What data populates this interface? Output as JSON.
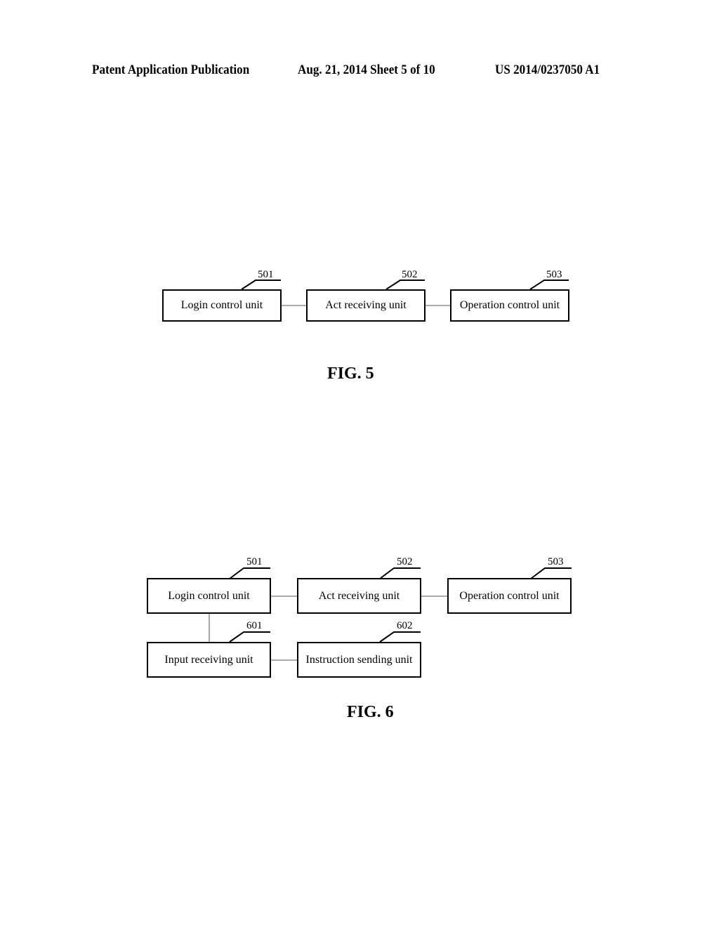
{
  "header": {
    "publication": "Patent Application Publication",
    "date_sheet": "Aug. 21, 2014  Sheet 5 of 10",
    "number": "US 2014/0237050 A1"
  },
  "fig5": {
    "caption": "FIG. 5",
    "boxes": [
      {
        "ref": "501",
        "label": "Login control unit"
      },
      {
        "ref": "502",
        "label": "Act receiving unit"
      },
      {
        "ref": "503",
        "label": "Operation control unit"
      }
    ]
  },
  "fig6": {
    "caption": "FIG. 6",
    "boxes": [
      {
        "ref": "501",
        "label": "Login control unit"
      },
      {
        "ref": "502",
        "label": "Act receiving unit"
      },
      {
        "ref": "503",
        "label": "Operation control unit"
      },
      {
        "ref": "601",
        "label": "Input receiving unit"
      },
      {
        "ref": "602",
        "label": "Instruction sending unit"
      }
    ]
  }
}
